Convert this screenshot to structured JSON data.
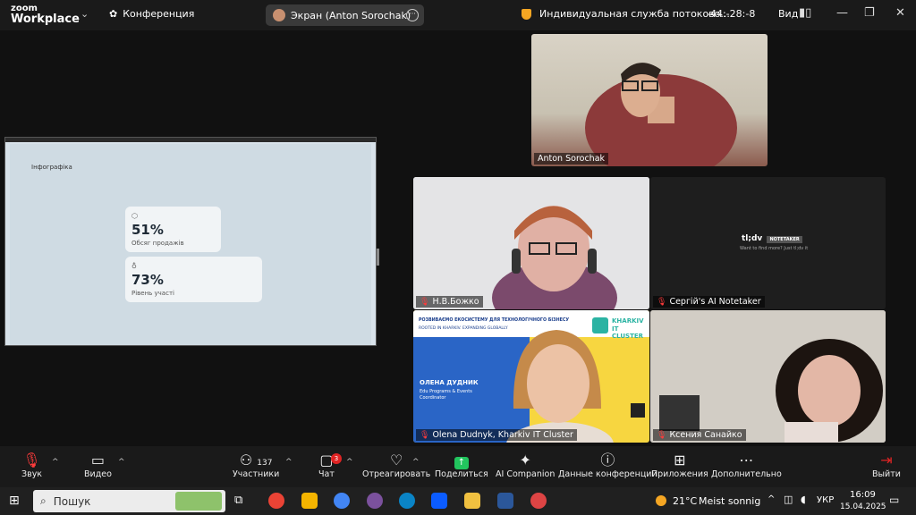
{
  "app": {
    "logo_line1": "zoom",
    "logo_line2": "Workplace",
    "conference": "Конференция",
    "screen_share": "Экран (Anton Sorochak)",
    "stream_title": "Индивидуальная служба потоково...",
    "timer": "-44:-28:-8",
    "view": "Вид"
  },
  "share": {
    "heading": "Інфографіка",
    "cards": [
      {
        "value": "51%",
        "label": "Обсяг продажів"
      },
      {
        "value": "73%",
        "label": "Рівень участі"
      }
    ]
  },
  "participants": [
    {
      "name": "Anton Sorochak"
    },
    {
      "name": "Н.В.Божко"
    },
    {
      "name": "Сергій's AI Notetaker"
    },
    {
      "name": "Olena Dudnyk, Kharkiv IT Cluster"
    },
    {
      "name": "Ксения Санайко"
    }
  ],
  "notetaker": {
    "brand": "tl;dv",
    "tag": "NOTETAKER",
    "sub": "Want to find more? Just tl;dv it"
  },
  "banner": {
    "line1": "РОЗВИВАЄМО ЕКОСИСТЕМУ ДЛЯ ТЕХНОЛОГІЧНОГО БІЗНЕСУ",
    "line2": "ROOTED IN KHARKIV. EXPANDING GLOBALLY",
    "org1": "KHARKIV",
    "org2": "IT CLUSTER",
    "person": "ОЛЕНА ДУДНИК",
    "role": "Edu Programs & Events Coordinator"
  },
  "toolbar": {
    "sound": "Звук",
    "video": "Видео",
    "participants": "Участники",
    "participants_count": "137",
    "chat": "Чат",
    "chat_badge": "3",
    "react": "Отреагировать",
    "share": "Поделиться",
    "ai": "AI Companion",
    "data": "Данные конференции",
    "apps": "Приложения",
    "more": "Дополнительно",
    "leave": "Выйти"
  },
  "taskbar": {
    "search": "Пошук",
    "temp": "21°C",
    "weather": "Meist sonnig",
    "lang": "УКР",
    "time": "16:09",
    "date": "15.04.2025"
  },
  "colors": {
    "zoom_blue": "#0b5cff",
    "leave_red": "#e02424",
    "mic_muted": "#ff3b3b"
  }
}
